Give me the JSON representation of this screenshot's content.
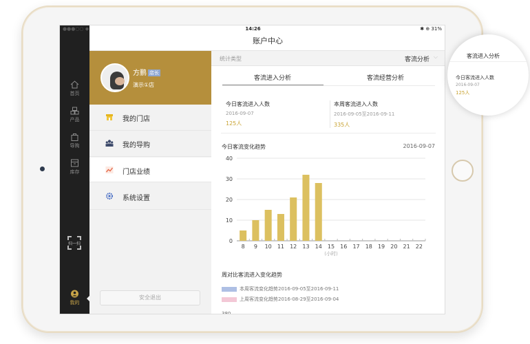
{
  "status_bar": {
    "left": "●●●○○ ◆",
    "time": "14:26",
    "right": "✱ ⊕ 31%"
  },
  "header": {
    "title": "账户中心"
  },
  "rail": {
    "items": [
      {
        "label": "首页",
        "icon": "home-icon"
      },
      {
        "label": "产品",
        "icon": "grid-icon"
      },
      {
        "label": "导购",
        "icon": "bag-icon"
      },
      {
        "label": "库存",
        "icon": "box-icon"
      }
    ],
    "scan_label": "扫一扫",
    "me_label": "我的"
  },
  "profile": {
    "name": "方鹏",
    "role_badge": "店长",
    "store": "演示①店"
  },
  "menu": {
    "items": [
      {
        "label": "我的门店",
        "icon": "store-icon",
        "color": "#e6b51e"
      },
      {
        "label": "我的导购",
        "icon": "people-icon",
        "color": "#3d4a6b"
      },
      {
        "label": "门店业绩",
        "icon": "chart-icon",
        "color": "#e46c4e"
      },
      {
        "label": "系统设置",
        "icon": "gear-icon",
        "color": "#4a6fc5"
      }
    ],
    "logout_label": "安全退出"
  },
  "filter": {
    "label": "统计类型",
    "value": "客流分析"
  },
  "tabs": [
    {
      "label": "客流进入分析"
    },
    {
      "label": "客流经营分析"
    }
  ],
  "stats": {
    "today": {
      "title": "今日客流进入人数",
      "date": "2016-09-07",
      "value": "125人"
    },
    "week": {
      "title": "本周客流进入人数",
      "date": "2016-09-05至2016-09-11",
      "value": "335人"
    }
  },
  "chart_section": {
    "title": "今日客流变化趋势",
    "date": "2016-09-07"
  },
  "chart_data": {
    "type": "bar",
    "categories": [
      "8",
      "9",
      "10",
      "11",
      "12",
      "13",
      "14",
      "15",
      "16",
      "17",
      "18",
      "19",
      "20",
      "21",
      "22"
    ],
    "values": [
      5,
      10,
      15,
      13,
      21,
      32,
      28,
      0,
      0,
      0,
      0,
      0,
      0,
      0,
      0
    ],
    "title": "今日客流变化趋势",
    "xlabel": "(小时)",
    "ylabel": "",
    "ylim": [
      0,
      40
    ],
    "yticks": [
      0,
      10,
      20,
      30,
      40
    ],
    "bar_color": "#dcc060",
    "grid": true
  },
  "compare": {
    "title": "周对比客流进入变化趋势",
    "legend": [
      {
        "label": "本周客流变化趋势2016-09-05至2016-09-11",
        "color": "#aebfe4"
      },
      {
        "label": "上周客流变化趋势2016-08-29至2016-09-04",
        "color": "#f3c8d6"
      }
    ],
    "axis_top_value": "380"
  },
  "zoom_callout": {
    "bar_title": "客流进入分析",
    "title": "今日客流进入人数",
    "date": "2016-09-07",
    "value": "125人"
  },
  "colors": {
    "accent": "#b58f3c",
    "value": "#c8a230",
    "rail": "#202020"
  }
}
